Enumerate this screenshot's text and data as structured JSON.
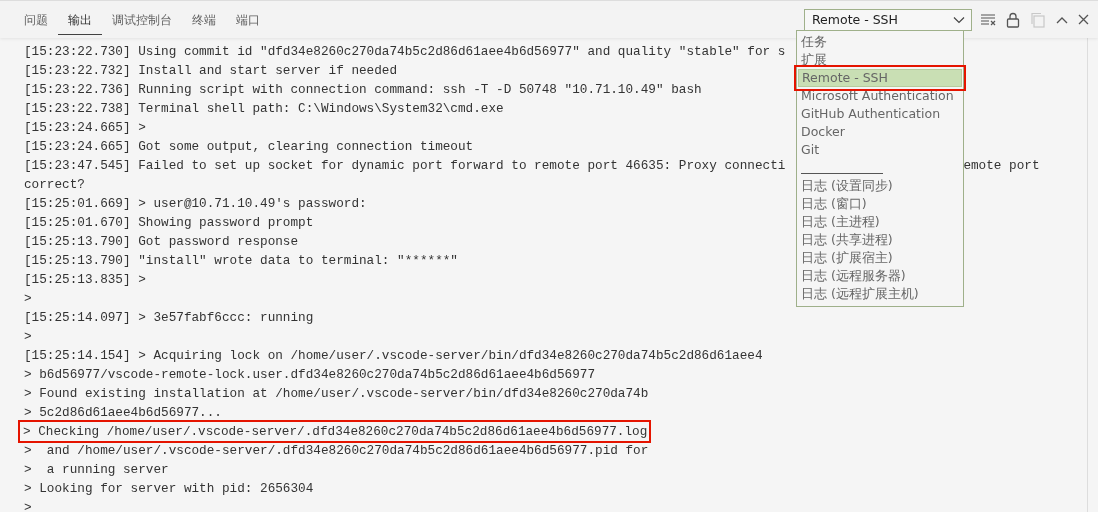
{
  "tabs": [
    {
      "label": "问题",
      "selected": false
    },
    {
      "label": "输出",
      "selected": true
    },
    {
      "label": "调试控制台",
      "selected": false
    },
    {
      "label": "终端",
      "selected": false
    },
    {
      "label": "端口",
      "selected": false
    }
  ],
  "channel_select": {
    "value": "Remote - SSH",
    "expanded": true,
    "options": [
      {
        "kind": "item",
        "label": "任务",
        "selected": false,
        "highlighted": false
      },
      {
        "kind": "item",
        "label": "扩展",
        "selected": false,
        "highlighted": false
      },
      {
        "kind": "item",
        "label": "Remote - SSH",
        "selected": true,
        "highlighted": true
      },
      {
        "kind": "item",
        "label": "Microsoft Authentication",
        "selected": false,
        "highlighted": false
      },
      {
        "kind": "item",
        "label": "GitHub Authentication",
        "selected": false,
        "highlighted": false
      },
      {
        "kind": "item",
        "label": "Docker",
        "selected": false,
        "highlighted": false
      },
      {
        "kind": "item",
        "label": "Git",
        "selected": false,
        "highlighted": false
      },
      {
        "kind": "separator"
      },
      {
        "kind": "item",
        "label": "日志 (设置同步)",
        "selected": false,
        "highlighted": false
      },
      {
        "kind": "item",
        "label": "日志 (窗口)",
        "selected": false,
        "highlighted": false
      },
      {
        "kind": "item",
        "label": "日志 (主进程)",
        "selected": false,
        "highlighted": false
      },
      {
        "kind": "item",
        "label": "日志 (共享进程)",
        "selected": false,
        "highlighted": false
      },
      {
        "kind": "item",
        "label": "日志 (扩展宿主)",
        "selected": false,
        "highlighted": false
      },
      {
        "kind": "item",
        "label": "日志 (远程服务器)",
        "selected": false,
        "highlighted": false
      },
      {
        "kind": "item",
        "label": "日志 (远程扩展主机)",
        "selected": false,
        "highlighted": false
      }
    ]
  },
  "toolbar": {
    "copy_disabled": true
  },
  "log_lines": [
    {
      "text": "[15:23:22.730] Using commit id \"dfd34e8260c270da74b5c2d86d61aee4b6d56977\" and quality \"stable\" for s",
      "highlighted": false
    },
    {
      "text": "[15:23:22.732] Install and start server if needed",
      "highlighted": false
    },
    {
      "text": "[15:23:22.736] Running script with connection command: ssh -T -D 50748 \"10.71.10.49\" bash",
      "highlighted": false
    },
    {
      "text": "[15:23:22.738] Terminal shell path: C:\\Windows\\System32\\cmd.exe",
      "highlighted": false
    },
    {
      "text": "[15:23:24.665] >",
      "highlighted": false
    },
    {
      "text": "[15:23:24.665] Got some output, clearing connection timeout",
      "highlighted": false
    },
    {
      "text": "[15:23:47.545] Failed to set up socket for dynamic port forward to remote port 46635: Proxy connecti",
      "text_after": "emote port",
      "highlighted": false
    },
    {
      "text": "correct?",
      "highlighted": false
    },
    {
      "text": "[15:25:01.669] > user@10.71.10.49's password:",
      "highlighted": false
    },
    {
      "text": "[15:25:01.670] Showing password prompt",
      "highlighted": false
    },
    {
      "text": "[15:25:13.790] Got password response",
      "highlighted": false
    },
    {
      "text": "[15:25:13.790] \"install\" wrote data to terminal: \"******\"",
      "highlighted": false
    },
    {
      "text": "[15:25:13.835] >",
      "highlighted": false
    },
    {
      "text": ">",
      "highlighted": false
    },
    {
      "text": "[15:25:14.097] > 3e57fabf6ccc: running",
      "highlighted": false
    },
    {
      "text": ">",
      "highlighted": false
    },
    {
      "text": "[15:25:14.154] > Acquiring lock on /home/user/.vscode-server/bin/dfd34e8260c270da74b5c2d86d61aee4",
      "highlighted": false
    },
    {
      "text": "> b6d56977/vscode-remote-lock.user.dfd34e8260c270da74b5c2d86d61aee4b6d56977",
      "highlighted": false
    },
    {
      "text": "> Found existing installation at /home/user/.vscode-server/bin/dfd34e8260c270da74b",
      "highlighted": false
    },
    {
      "text": "> 5c2d86d61aee4b6d56977...",
      "highlighted": false
    },
    {
      "text": "> Checking /home/user/.vscode-server/.dfd34e8260c270da74b5c2d86d61aee4b6d56977.log",
      "highlighted": true
    },
    {
      "text": ">  and /home/user/.vscode-server/.dfd34e8260c270da74b5c2d86d61aee4b6d56977.pid for",
      "highlighted": false
    },
    {
      "text": ">  a running server",
      "highlighted": false
    },
    {
      "text": "> Looking for server with pid: 2656304",
      "highlighted": false
    },
    {
      "text": ">",
      "highlighted": false
    }
  ]
}
